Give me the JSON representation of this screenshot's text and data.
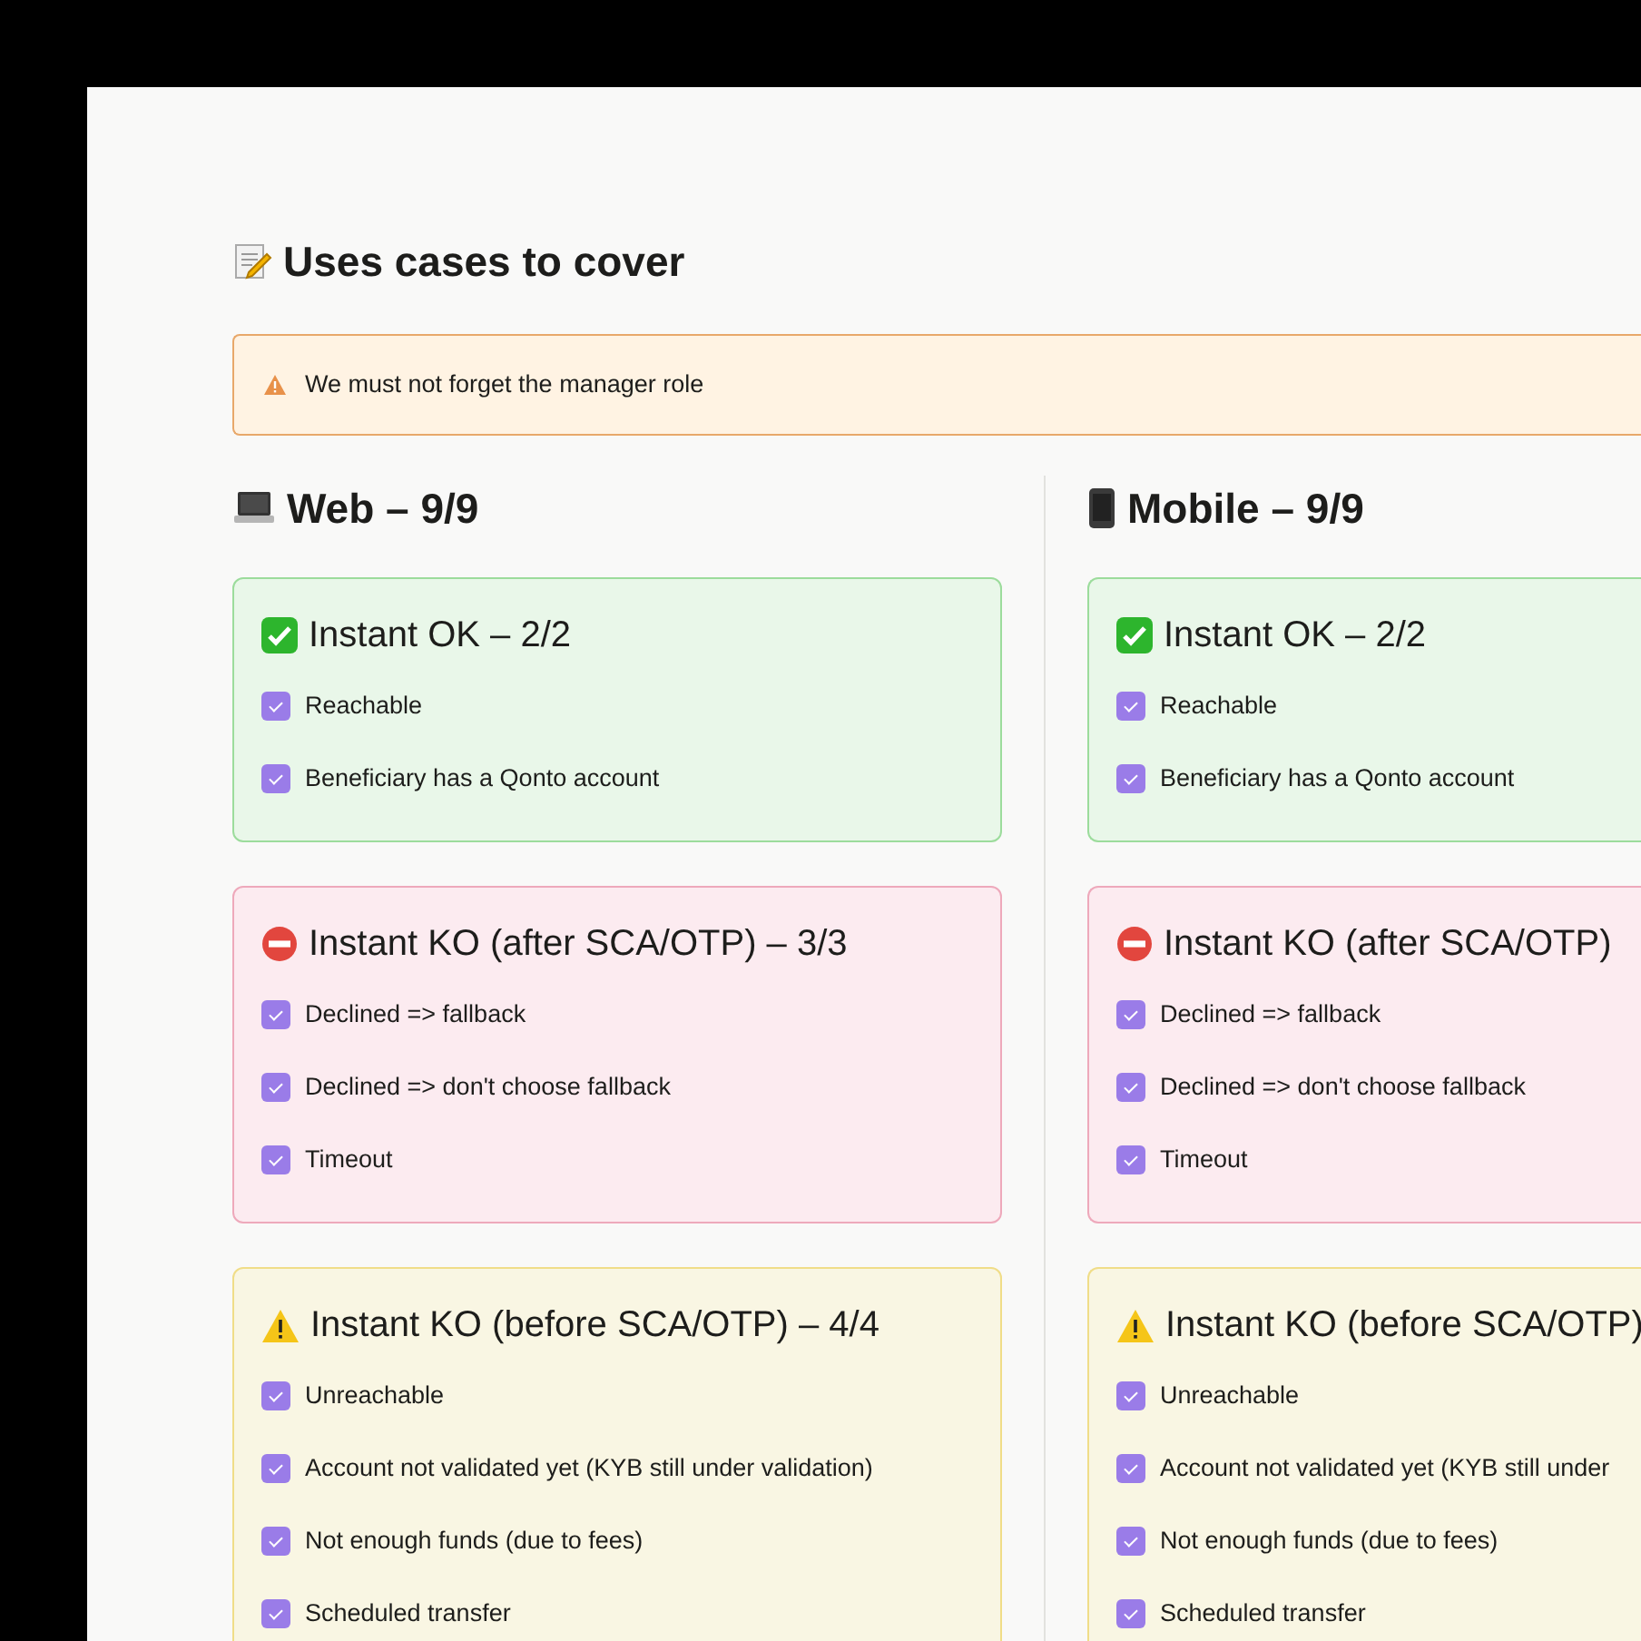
{
  "page": {
    "title": "Uses cases to cover"
  },
  "callout": {
    "text": "We must not forget the manager role"
  },
  "columns": [
    {
      "kind": "laptop",
      "title": "Web – 9/9",
      "groups": [
        {
          "kind": "ok",
          "title": "Instant OK – 2/2",
          "items": [
            {
              "label": "Reachable",
              "checked": true
            },
            {
              "label": "Beneficiary has a Qonto account",
              "checked": true
            }
          ]
        },
        {
          "kind": "blocked",
          "title": "Instant KO (after SCA/OTP) – 3/3",
          "items": [
            {
              "label": "Declined => fallback",
              "checked": true
            },
            {
              "label": "Declined => don't choose fallback",
              "checked": true
            },
            {
              "label": "Timeout",
              "checked": true
            }
          ]
        },
        {
          "kind": "warning",
          "title": "Instant KO (before SCA/OTP) – 4/4",
          "items": [
            {
              "label": "Unreachable",
              "checked": true
            },
            {
              "label": "Account not validated yet (KYB still under validation)",
              "checked": true
            },
            {
              "label": "Not enough funds (due to fees)",
              "checked": true
            },
            {
              "label": "Scheduled transfer",
              "checked": true
            }
          ]
        }
      ]
    },
    {
      "kind": "phone",
      "title": "Mobile – 9/9",
      "groups": [
        {
          "kind": "ok",
          "title": "Instant OK – 2/2",
          "items": [
            {
              "label": "Reachable",
              "checked": true
            },
            {
              "label": "Beneficiary has a Qonto account",
              "checked": true
            }
          ]
        },
        {
          "kind": "blocked",
          "title": "Instant KO (after SCA/OTP)",
          "items": [
            {
              "label": "Declined => fallback",
              "checked": true
            },
            {
              "label": "Declined => don't choose fallback",
              "checked": true
            },
            {
              "label": "Timeout",
              "checked": true
            }
          ]
        },
        {
          "kind": "warning",
          "title": "Instant KO (before SCA/OTP)",
          "items": [
            {
              "label": "Unreachable",
              "checked": true
            },
            {
              "label": "Account not validated yet (KYB still under",
              "checked": true
            },
            {
              "label": "Not enough funds (due to fees)",
              "checked": true
            },
            {
              "label": "Scheduled transfer",
              "checked": true
            }
          ]
        }
      ]
    }
  ]
}
